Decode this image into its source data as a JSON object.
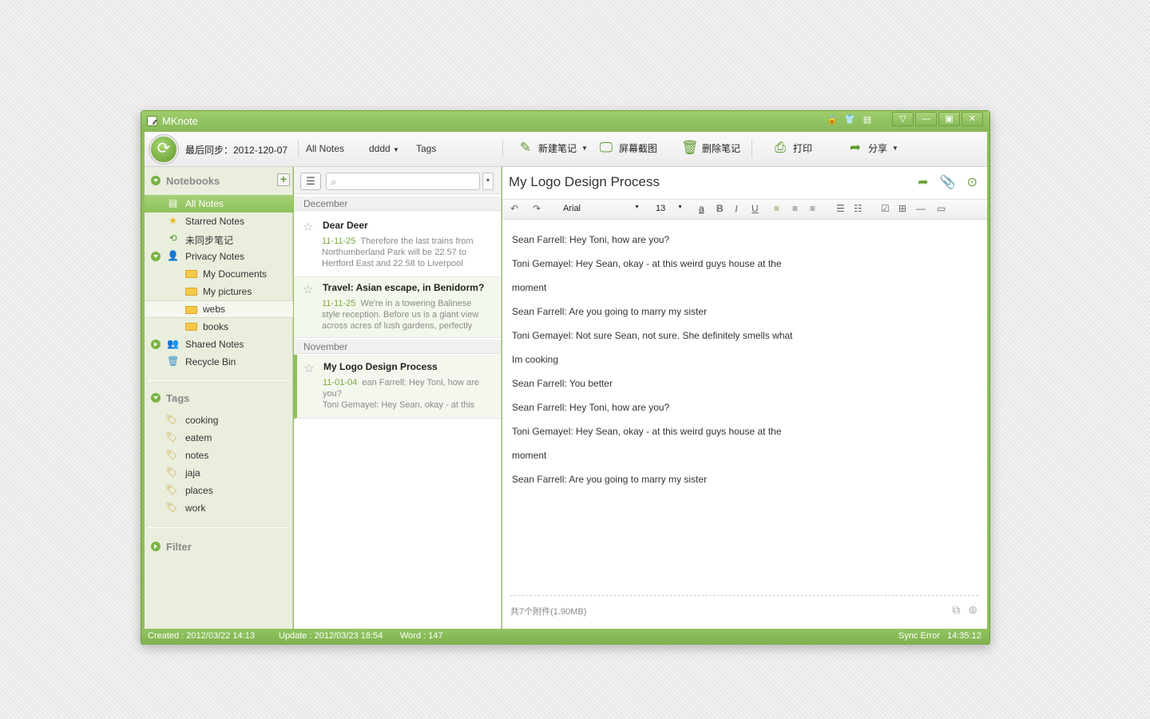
{
  "window": {
    "title": "MKnote"
  },
  "toolbar": {
    "last_sync": "最后同步：2012-120-07",
    "all_notes": "All Notes",
    "notebook_filter": "dddd",
    "tags": "Tags",
    "new_note": "新建笔记",
    "screenshot": "屏幕截图",
    "delete_note": "删除笔记",
    "print": "打印",
    "share": "分享"
  },
  "sidebar": {
    "notebooks_header": "Notebooks",
    "items": [
      {
        "label": "All Notes"
      },
      {
        "label": "Starred Notes"
      },
      {
        "label": "未同步笔记"
      },
      {
        "label": "Privacy Notes"
      },
      {
        "label": "My Documents"
      },
      {
        "label": "My pictures"
      },
      {
        "label": "webs"
      },
      {
        "label": "books"
      },
      {
        "label": "Shared Notes"
      },
      {
        "label": "Recycle Bin"
      }
    ],
    "tags_header": "Tags",
    "tags": [
      "cooking",
      "eatem",
      "notes",
      "jaja",
      "places",
      "work"
    ],
    "filter_header": "Filter"
  },
  "notelist": {
    "search_placeholder": "",
    "groups": [
      "December",
      "November"
    ],
    "notes": [
      {
        "title": "Dear Deer",
        "date": "11-11-25",
        "snippet": "Therefore the last trains from Northumberland Park will be 22.57 to Hertford East and 22.58 to Liverpool"
      },
      {
        "title": "Travel: Asian escape, in Benidorm?",
        "date": "11-11-25",
        "snippet": "We're in a towering Balinese style reception. Before us is a giant view across acres of lush gardens, perfectly"
      },
      {
        "title": "My  Logo Design Process",
        "date": "11-01-04",
        "snippet": "ean Farrell:  Hey Toni, how are you?",
        "snippet2": "Toni Gemayel:  Hey Sean, okay - at this"
      }
    ]
  },
  "editor": {
    "title": "My Logo Design Process",
    "font": "Arial",
    "size": "13",
    "lines": [
      "Sean Farrell:  Hey Toni, how are you?",
      "Toni Gemayel:  Hey Sean, okay - at this weird guys house at the",
      "moment",
      "Sean Farrell:  Are you going to marry my sister",
      "Toni Gemayel:  Not sure Sean, not sure.  She definitely smells what",
      "Im cooking",
      "Sean Farrell:  You better",
      "Sean Farrell:  Hey Toni, how are you?",
      "Toni Gemayel:  Hey Sean, okay - at this weird guys house at the",
      "moment",
      "Sean Farrell:  Are you going to marry my sister"
    ],
    "attachments": "共7个附件(1.90MB)"
  },
  "status": {
    "created": "Created :  2012/03/22  14:13",
    "update": "Update :  2012/03/23 18:54",
    "word": "Word : 147",
    "sync": "Sync Error",
    "time": "14:35:12"
  },
  "colors": {
    "accent": "#8cbf5a",
    "accent_dark": "#6d9d41",
    "date": "#77a83f"
  }
}
